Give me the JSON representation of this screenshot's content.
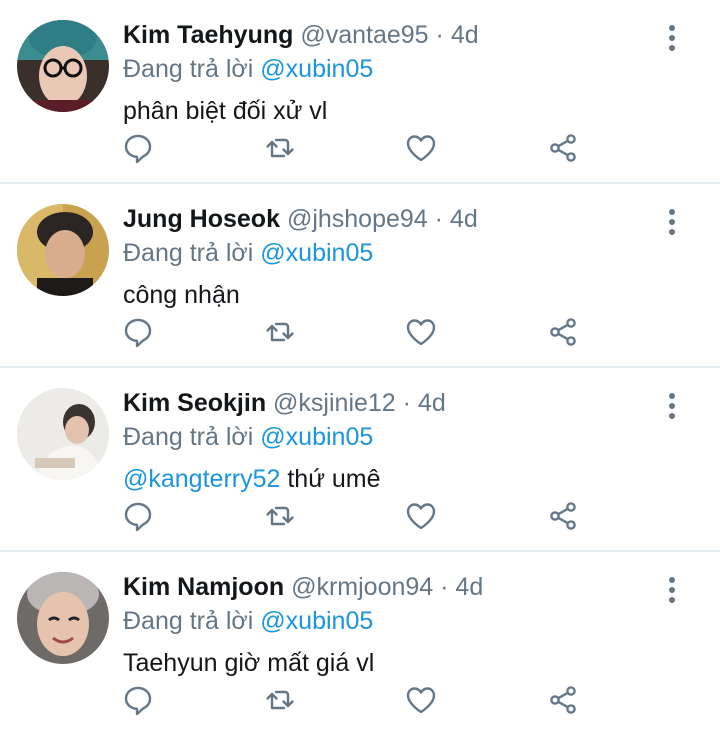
{
  "colors": {
    "text": "#14171a",
    "secondary": "#657786",
    "link": "#1b95e0",
    "divider": "#e6ecf0"
  },
  "tweets": [
    {
      "name": "Kim Taehyung",
      "handle": "@vantae95",
      "separator": "·",
      "time": "4d",
      "replying_prefix": "Đang trả lời",
      "replying_to": "@xubin05",
      "text_mention": "",
      "text": "phân biệt đối xử vl",
      "avatar_icon": "profile-photo"
    },
    {
      "name": "Jung Hoseok",
      "handle": "@jhshope94",
      "separator": "·",
      "time": "4d",
      "replying_prefix": "Đang trả lời",
      "replying_to": "@xubin05",
      "text_mention": "",
      "text": "công nhận",
      "avatar_icon": "profile-photo"
    },
    {
      "name": "Kim Seokjin",
      "handle": "@ksjinie12",
      "separator": "·",
      "time": "4d",
      "replying_prefix": "Đang trả lời",
      "replying_to": "@xubin05",
      "text_mention": "@kangterry52",
      "text": " thứ umê",
      "avatar_icon": "profile-photo"
    },
    {
      "name": "Kim Namjoon",
      "handle": "@krmjoon94",
      "separator": "·",
      "time": "4d",
      "replying_prefix": "Đang trả lời",
      "replying_to": "@xubin05",
      "text_mention": "",
      "text": "Taehyun giờ mất giá vl",
      "avatar_icon": "profile-photo"
    }
  ],
  "action_icons": [
    "reply-icon",
    "retweet-icon",
    "like-icon",
    "share-icon"
  ]
}
